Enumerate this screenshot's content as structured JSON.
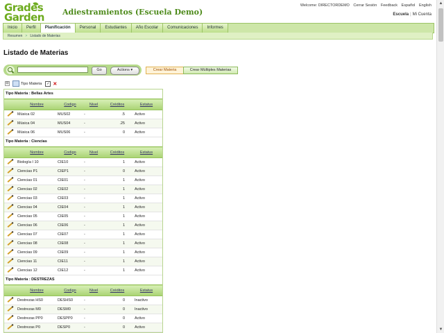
{
  "logo": {
    "line1": "Grades",
    "line2": "Garden"
  },
  "app_title": "Adiestramientos (Escuela Demo)",
  "top_links": [
    "Welcome: DIRECTORDEMO",
    "Cerrar Sesión",
    "Feedback",
    "Español",
    "English"
  ],
  "school": {
    "label": "Escuela",
    "account": "Mi Cuenta",
    "separator": "|"
  },
  "nav": {
    "tabs": [
      "Inicio",
      "Perfil",
      "Planificación",
      "Personal",
      "Estudiantes",
      "Año Escolar",
      "Comunicaciones",
      "Informes"
    ],
    "active": "Planificación"
  },
  "breadcrumb": {
    "root": "Resumen",
    "separator": ">",
    "current": "Listado de Materias"
  },
  "page_title": "Listado de Materias",
  "search": {
    "placeholder": "",
    "go_label": "Go",
    "actions_label": "Actions ▾"
  },
  "buttons": {
    "create": "Crear Materia",
    "create_multiple": "Crear Múltiples Materias"
  },
  "grouping": {
    "minus": "⊟",
    "label": "Tipo Materia",
    "check": "✓",
    "remove": "✕"
  },
  "columns": [
    "Nombre",
    "Codigo",
    "Nivel",
    "Créditos",
    "Estatus"
  ],
  "groups": [
    {
      "title": "Tipo Materia : Bellas Artes",
      "rows": [
        [
          "Música 02",
          "MUS02",
          "-",
          ".5",
          "Activo"
        ],
        [
          "Música 04",
          "MUS04",
          "-",
          ".25",
          "Activo"
        ],
        [
          "Música 06",
          "MUS06",
          "-",
          "0",
          "Activo"
        ]
      ]
    },
    {
      "title": "Tipo Materia : Ciencias",
      "rows": [
        [
          "Biología I 10",
          "CIE10",
          "-",
          "1",
          "Activo"
        ],
        [
          "Ciencias P1",
          "CIEP1",
          "-",
          "0",
          "Activo"
        ],
        [
          "Ciencias 01",
          "CIE01",
          "-",
          "1",
          "Activo"
        ],
        [
          "Ciencias 02",
          "CIE02",
          "-",
          "1",
          "Activo"
        ],
        [
          "Ciencias 03",
          "CIE03",
          "-",
          "1",
          "Activo"
        ],
        [
          "Ciencias 04",
          "CIE04",
          "-",
          "1",
          "Activo"
        ],
        [
          "Ciencias 05",
          "CIE05",
          "-",
          "1",
          "Activo"
        ],
        [
          "Ciencias 06",
          "CIE06",
          "-",
          "1",
          "Activo"
        ],
        [
          "Ciencias 07",
          "CIE07",
          "-",
          "1",
          "Activo"
        ],
        [
          "Ciencias 08",
          "CIE08",
          "-",
          "1",
          "Activo"
        ],
        [
          "Ciencias 09",
          "CIE09",
          "-",
          "1",
          "Activo"
        ],
        [
          "Ciencias 11",
          "CIE11",
          "-",
          "1",
          "Activo"
        ],
        [
          "Ciencias 12",
          "CIE12",
          "-",
          "1",
          "Activo"
        ]
      ]
    },
    {
      "title": "Tipo Materia : DESTREZAS",
      "rows": [
        [
          "Destrezas HS0",
          "DESHS0",
          "-",
          "0",
          "Inactivo"
        ],
        [
          "Destrezas M0",
          "DESM0",
          "-",
          "0",
          "Inactivo"
        ],
        [
          "Destrezas PP0",
          "DESPP0",
          "-",
          "0",
          "Activo"
        ],
        [
          "Destrezas P0",
          "DESP0",
          "-",
          "0",
          "Activo"
        ]
      ]
    }
  ],
  "scrollbar": {
    "up": "▲",
    "down": "▼"
  }
}
